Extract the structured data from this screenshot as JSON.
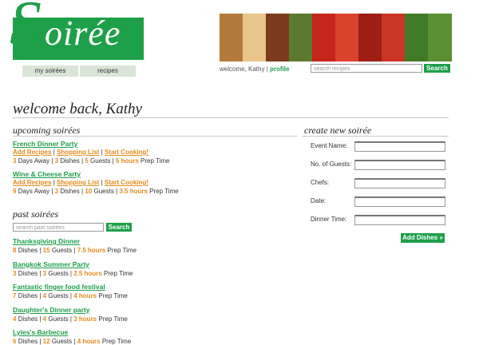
{
  "logo": {
    "s": "S",
    "rest": "oirée"
  },
  "nav": {
    "my_soirees": "my soirées",
    "recipes": "recipes"
  },
  "header": {
    "welcome_prefix": "welcome, Kathy",
    "separator": "|",
    "profile": "profile",
    "search_placeholder": "search recipes",
    "search_button": "Search"
  },
  "photos": [
    "#b47a3b",
    "#e8c58a",
    "#7b3b1c",
    "#5c7a2f",
    "#c4261b",
    "#d9422c",
    "#9e1d14",
    "#c93524",
    "#3f7a28",
    "#5a8f32"
  ],
  "greeting": "welcome back, Kathy",
  "upcoming": {
    "heading": "upcoming soirées",
    "parties": [
      {
        "title": "French Dinner Party",
        "actions": [
          "Add Recipes",
          "Shopping List",
          "Start Cooking!"
        ],
        "days": "3",
        "days_label": "Days Away",
        "dishes": "3",
        "dishes_label": "Dishes",
        "guests": "5",
        "guests_label": "Guests",
        "prep": "5 hours",
        "prep_label": "Prep Time"
      },
      {
        "title": "Wine & Cheese Party",
        "actions": [
          "Add Recipes",
          "Shopping List",
          "Start Cooking!"
        ],
        "days": "9",
        "days_label": "Days Away",
        "dishes": "3",
        "dishes_label": "Dishes",
        "guests": "10",
        "guests_label": "Guests",
        "prep": "3.5 hours",
        "prep_label": "Prep Time"
      }
    ]
  },
  "past": {
    "heading": "past soirées",
    "search_placeholder": "search past soirées",
    "search_button": "Search",
    "parties": [
      {
        "title": "Thanksgiving Dinner",
        "dishes": "8",
        "guests": "15",
        "prep": "7.5 hours"
      },
      {
        "title": "Bangkok Summer Party",
        "dishes": "3",
        "guests": "3",
        "prep": "2.5 hours"
      },
      {
        "title": "Fantastic finger food festival",
        "dishes": "7",
        "guests": "4",
        "prep": "4 hours"
      },
      {
        "title": "Daughter's Dinner party",
        "dishes": "4",
        "guests": "4",
        "prep": "3 hours"
      },
      {
        "title": "Lyles's Barbecue",
        "dishes": "6",
        "guests": "12",
        "prep": "4 hours"
      }
    ],
    "dishes_label": "Dishes",
    "guests_label": "Guests",
    "prep_label": "Prep Time"
  },
  "create": {
    "heading": "create new soirée",
    "fields": [
      "Event Name:",
      "No. of Guests:",
      "Chefs:",
      "Date:",
      "Dinner Time:"
    ],
    "button": "Add Dishes »"
  },
  "colors": {
    "brand_green": "#1e9f49",
    "accent_orange": "#e48b1c",
    "nav_bg": "#d9e5d6"
  }
}
